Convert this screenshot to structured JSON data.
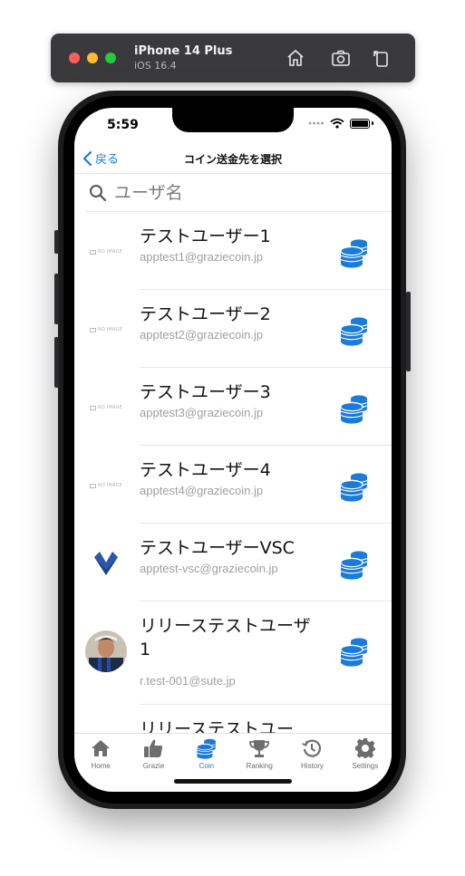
{
  "simulator": {
    "device_name": "iPhone 14 Plus",
    "os_version": "iOS 16.4",
    "buttons": [
      "home-icon",
      "screenshot-icon",
      "rotate-icon"
    ]
  },
  "status_bar": {
    "time": "5:59"
  },
  "nav": {
    "back_label": "戻る",
    "title": "コイン送金先を選択"
  },
  "search": {
    "placeholder": "ユーザ名",
    "value": ""
  },
  "users": [
    {
      "name": "テストユーザー1",
      "email": "apptest1@graziecoin.jp",
      "avatar": "no-image"
    },
    {
      "name": "テストユーザー2",
      "email": "apptest2@graziecoin.jp",
      "avatar": "no-image"
    },
    {
      "name": "テストユーザー3",
      "email": "apptest3@graziecoin.jp",
      "avatar": "no-image"
    },
    {
      "name": "テストユーザー4",
      "email": "apptest4@graziecoin.jp",
      "avatar": "no-image"
    },
    {
      "name": "テストユーザーVSC",
      "email": "apptest-vsc@graziecoin.jp",
      "avatar": "logo"
    },
    {
      "name": "リリーステストユーザ1",
      "email": "r.test-001@sute.jp",
      "avatar": "photo"
    },
    {
      "name": "リリーステストユー",
      "email": "",
      "avatar": "none"
    }
  ],
  "no_image_text": "NO IMAGE",
  "tab_bar": {
    "active": "Coin",
    "tabs": [
      {
        "label": "Home",
        "icon": "home-icon"
      },
      {
        "label": "Grazie",
        "icon": "thumbs-up-icon"
      },
      {
        "label": "Coin",
        "icon": "coins-icon"
      },
      {
        "label": "Ranking",
        "icon": "trophy-icon"
      },
      {
        "label": "History",
        "icon": "history-icon"
      },
      {
        "label": "Settings",
        "icon": "gear-icon"
      }
    ]
  },
  "colors": {
    "accent": "#1a7bd9",
    "text": "#111111",
    "muted": "#a0a0a0"
  }
}
